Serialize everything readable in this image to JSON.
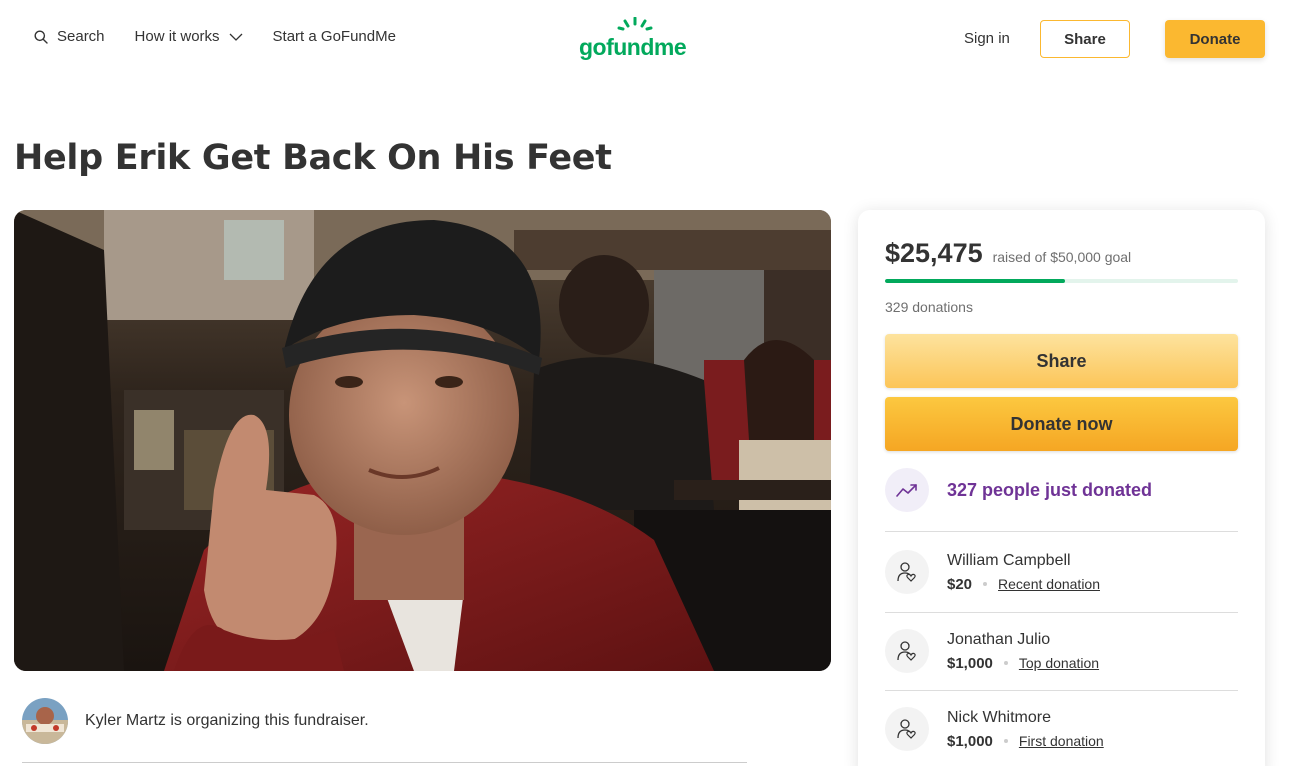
{
  "header": {
    "search_label": "Search",
    "how_it_works_label": "How it works",
    "start_label": "Start a GoFundMe",
    "logo_text": "gofundme",
    "signin_label": "Sign in",
    "share_label": "Share",
    "donate_label": "Donate"
  },
  "colors": {
    "brand_green": "#02a95c",
    "accent_yellow": "#fbb830",
    "trend_purple": "#6f3396"
  },
  "campaign": {
    "title": "Help Erik Get Back On His Feet",
    "organizer_text": "Kyler Martz is organizing this fundraiser."
  },
  "donation_card": {
    "raised_amount": "$25,475",
    "raised_of_text": "raised of $50,000 goal",
    "progress_fraction": 0.51,
    "donation_count": "329 donations",
    "share_label": "Share",
    "donate_now_label": "Donate now",
    "trend_text": "327 people just donated",
    "trend_icon": "trending-up-icon",
    "donors": [
      {
        "name": "William Campbell",
        "amount": "$20",
        "tag": "Recent donation",
        "icon": "donor-heart-icon"
      },
      {
        "name": "Jonathan Julio",
        "amount": "$1,000",
        "tag": "Top donation",
        "icon": "donor-heart-icon"
      },
      {
        "name": "Nick Whitmore",
        "amount": "$1,000",
        "tag": "First donation",
        "icon": "donor-heart-icon"
      }
    ]
  }
}
